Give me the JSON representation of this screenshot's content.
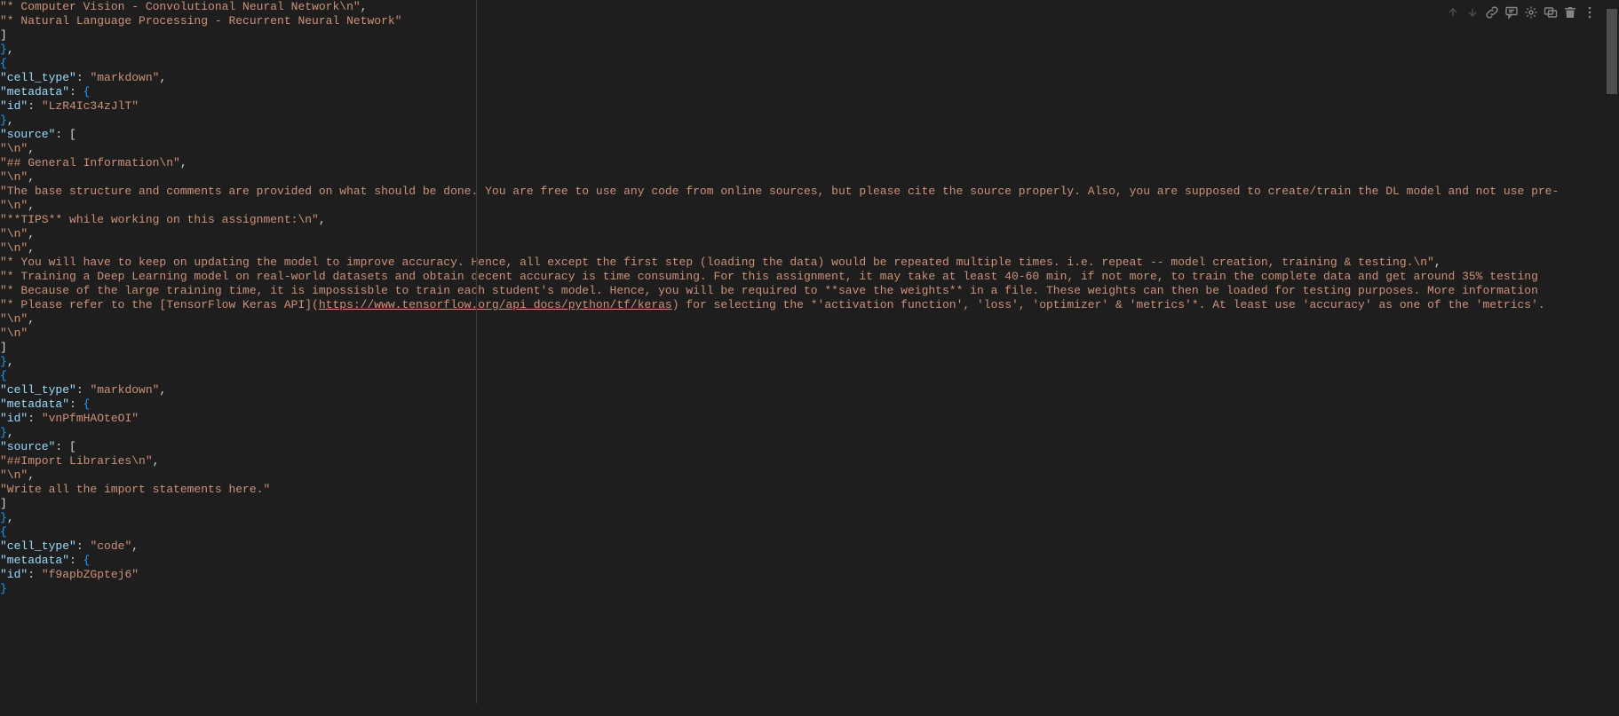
{
  "colors": {
    "background": "#1e1e1e",
    "foreground": "#d4d4d4",
    "key": "#9cdcfe",
    "string": "#ce9178",
    "brace": "#179fff"
  },
  "toolbar": {
    "move_up": "Move Cell Up",
    "move_down": "Move Cell Down",
    "link": "Insert Link",
    "comment": "Add Comment",
    "settings": "Editor Settings",
    "mirror": "Mirror Cell",
    "delete": "Delete Cell",
    "more": "More Actions"
  },
  "lines": [
    {
      "ind": 3,
      "segs": [
        {
          "t": "str",
          "v": "\"*   Computer Vision - Convolutional Neural Network\\n\""
        },
        {
          "t": "pun",
          "v": ","
        }
      ]
    },
    {
      "ind": 3,
      "segs": [
        {
          "t": "str",
          "v": "\"*   Natural Language Processing - Recurrent Neural Network\""
        }
      ]
    },
    {
      "ind": 2,
      "segs": [
        {
          "t": "pun",
          "v": "]"
        }
      ]
    },
    {
      "ind": 1,
      "segs": [
        {
          "t": "brace",
          "v": "}"
        },
        {
          "t": "pun",
          "v": ","
        }
      ]
    },
    {
      "ind": 1,
      "segs": [
        {
          "t": "brace",
          "v": "{"
        }
      ]
    },
    {
      "ind": 2,
      "segs": [
        {
          "t": "key",
          "v": "\"cell_type\""
        },
        {
          "t": "pun",
          "v": ": "
        },
        {
          "t": "str",
          "v": "\"markdown\""
        },
        {
          "t": "pun",
          "v": ","
        }
      ]
    },
    {
      "ind": 2,
      "segs": [
        {
          "t": "key",
          "v": "\"metadata\""
        },
        {
          "t": "pun",
          "v": ": "
        },
        {
          "t": "brace",
          "v": "{"
        }
      ]
    },
    {
      "ind": 3,
      "segs": [
        {
          "t": "key",
          "v": "\"id\""
        },
        {
          "t": "pun",
          "v": ": "
        },
        {
          "t": "str",
          "v": "\"LzR4Ic34zJlT\""
        }
      ]
    },
    {
      "ind": 2,
      "segs": [
        {
          "t": "brace",
          "v": "}"
        },
        {
          "t": "pun",
          "v": ","
        }
      ]
    },
    {
      "ind": 2,
      "segs": [
        {
          "t": "key",
          "v": "\"source\""
        },
        {
          "t": "pun",
          "v": ": ["
        }
      ]
    },
    {
      "ind": 3,
      "segs": [
        {
          "t": "str",
          "v": "\"\\n\""
        },
        {
          "t": "pun",
          "v": ","
        }
      ]
    },
    {
      "ind": 3,
      "segs": [
        {
          "t": "str",
          "v": "\"## General Information\\n\""
        },
        {
          "t": "pun",
          "v": ","
        }
      ]
    },
    {
      "ind": 3,
      "segs": [
        {
          "t": "str",
          "v": "\"\\n\""
        },
        {
          "t": "pun",
          "v": ","
        }
      ]
    },
    {
      "ind": 3,
      "segs": [
        {
          "t": "str",
          "v": "\"The base structure and comments are provided on what should be done. You are free to use any code from online sources, but please cite the source properly. Also, you are supposed to create/train the DL model and not use pre-"
        }
      ]
    },
    {
      "ind": 3,
      "segs": [
        {
          "t": "str",
          "v": "\"\\n\""
        },
        {
          "t": "pun",
          "v": ","
        }
      ]
    },
    {
      "ind": 3,
      "segs": [
        {
          "t": "str",
          "v": "\"**TIPS** while working on this assignment:\\n\""
        },
        {
          "t": "pun",
          "v": ","
        }
      ]
    },
    {
      "ind": 3,
      "segs": [
        {
          "t": "str",
          "v": "\"\\n\""
        },
        {
          "t": "pun",
          "v": ","
        }
      ]
    },
    {
      "ind": 3,
      "segs": [
        {
          "t": "str",
          "v": "\"\\n\""
        },
        {
          "t": "pun",
          "v": ","
        }
      ]
    },
    {
      "ind": 3,
      "segs": [
        {
          "t": "str",
          "v": "\"*   You will have to keep on updating the model to improve accuracy. Hence, all except the first step (loading the data) would be repeated multiple times. i.e. repeat -- model creation, training & testing.\\n\""
        },
        {
          "t": "pun",
          "v": ","
        }
      ]
    },
    {
      "ind": 3,
      "segs": [
        {
          "t": "str",
          "v": "\"*   Training a Deep Learning model on real-world datasets and obtain decent accuracy is time consuming. For this assignment, it may take at least 40-60 min, if not more, to train the complete data and get around 35% testing"
        }
      ]
    },
    {
      "ind": 3,
      "segs": [
        {
          "t": "str",
          "v": "\"*   Because of the large training time, it is impossisble to train each student's model. Hence, you will be required to **save the weights** in a file. These weights can then be loaded for testing purposes. More information"
        }
      ]
    },
    {
      "ind": 3,
      "segs": [
        {
          "t": "str",
          "v": "\"*   Please refer to the [TensorFlow Keras API]("
        },
        {
          "t": "link",
          "v": "https://www.tensorflow.org/api_docs/python/tf/keras"
        },
        {
          "t": "str",
          "v": ") for selecting the *'activation function', 'loss', 'optimizer' & 'metrics'*. At least use 'accuracy' as one of the 'metrics'."
        }
      ]
    },
    {
      "ind": 3,
      "segs": [
        {
          "t": "str",
          "v": "\"\\n\""
        },
        {
          "t": "pun",
          "v": ","
        }
      ]
    },
    {
      "ind": 3,
      "segs": [
        {
          "t": "str",
          "v": "\"\\n\""
        }
      ]
    },
    {
      "ind": 2,
      "segs": [
        {
          "t": "pun",
          "v": "]"
        }
      ]
    },
    {
      "ind": 1,
      "segs": [
        {
          "t": "brace",
          "v": "}"
        },
        {
          "t": "pun",
          "v": ","
        }
      ]
    },
    {
      "ind": 1,
      "segs": [
        {
          "t": "brace",
          "v": "{"
        }
      ]
    },
    {
      "ind": 2,
      "segs": [
        {
          "t": "key",
          "v": "\"cell_type\""
        },
        {
          "t": "pun",
          "v": ": "
        },
        {
          "t": "str",
          "v": "\"markdown\""
        },
        {
          "t": "pun",
          "v": ","
        }
      ]
    },
    {
      "ind": 2,
      "segs": [
        {
          "t": "key",
          "v": "\"metadata\""
        },
        {
          "t": "pun",
          "v": ": "
        },
        {
          "t": "brace",
          "v": "{"
        }
      ]
    },
    {
      "ind": 3,
      "segs": [
        {
          "t": "key",
          "v": "\"id\""
        },
        {
          "t": "pun",
          "v": ": "
        },
        {
          "t": "str",
          "v": "\"vnPfmHAOteOI\""
        }
      ]
    },
    {
      "ind": 2,
      "segs": [
        {
          "t": "brace",
          "v": "}"
        },
        {
          "t": "pun",
          "v": ","
        }
      ]
    },
    {
      "ind": 2,
      "segs": [
        {
          "t": "key",
          "v": "\"source\""
        },
        {
          "t": "pun",
          "v": ": ["
        }
      ]
    },
    {
      "ind": 3,
      "segs": [
        {
          "t": "str",
          "v": "\"##Import Libraries\\n\""
        },
        {
          "t": "pun",
          "v": ","
        }
      ]
    },
    {
      "ind": 3,
      "segs": [
        {
          "t": "str",
          "v": "\"\\n\""
        },
        {
          "t": "pun",
          "v": ","
        }
      ]
    },
    {
      "ind": 3,
      "segs": [
        {
          "t": "str",
          "v": "\"Write all the import statements here.\""
        }
      ]
    },
    {
      "ind": 2,
      "segs": [
        {
          "t": "pun",
          "v": "]"
        }
      ]
    },
    {
      "ind": 1,
      "segs": [
        {
          "t": "brace",
          "v": "}"
        },
        {
          "t": "pun",
          "v": ","
        }
      ]
    },
    {
      "ind": 1,
      "segs": [
        {
          "t": "brace",
          "v": "{"
        }
      ]
    },
    {
      "ind": 2,
      "segs": [
        {
          "t": "key",
          "v": "\"cell_type\""
        },
        {
          "t": "pun",
          "v": ": "
        },
        {
          "t": "str",
          "v": "\"code\""
        },
        {
          "t": "pun",
          "v": ","
        }
      ]
    },
    {
      "ind": 2,
      "segs": [
        {
          "t": "key",
          "v": "\"metadata\""
        },
        {
          "t": "pun",
          "v": ": "
        },
        {
          "t": "brace",
          "v": "{"
        }
      ]
    },
    {
      "ind": 3,
      "segs": [
        {
          "t": "key",
          "v": "\"id\""
        },
        {
          "t": "pun",
          "v": ": "
        },
        {
          "t": "str",
          "v": "\"f9apbZGptej6\""
        }
      ]
    },
    {
      "ind": 2,
      "segs": [
        {
          "t": "brace",
          "v": "}"
        }
      ]
    }
  ]
}
